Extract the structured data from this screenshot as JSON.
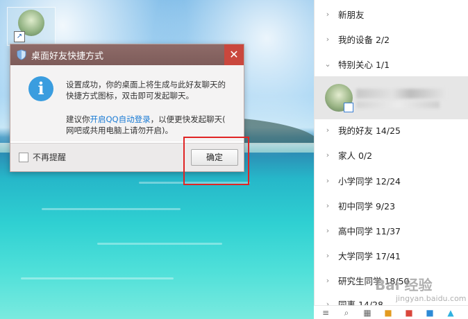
{
  "dialog": {
    "title": "桌面好友快捷方式",
    "close_symbol": "✕",
    "message_line1": "设置成功，你的桌面上将生成与此好友聊天的",
    "message_line2": "快捷方式图标，双击即可发起聊天。",
    "suggest_prefix": "建议你",
    "suggest_link": "开启QQ自动登录",
    "suggest_suffix": "，以便更快发起聊天(",
    "suggest_line2": "网吧或共用电脑上请勿开启)。",
    "info_symbol": "i",
    "dont_remind_label": "不再提醒",
    "confirm_button": "确定"
  },
  "contacts": {
    "groups": [
      {
        "label": "新朋友",
        "chevron": "›",
        "expanded": false
      },
      {
        "label": "我的设备 2/2",
        "chevron": "›",
        "expanded": false
      },
      {
        "label": "特别关心 1/1",
        "chevron": "⌄",
        "expanded": true
      },
      {
        "label": "我的好友 14/25",
        "chevron": "›",
        "expanded": false
      },
      {
        "label": "家人 0/2",
        "chevron": "›",
        "expanded": false
      },
      {
        "label": "小学同学 12/24",
        "chevron": "›",
        "expanded": false
      },
      {
        "label": "初中同学 9/23",
        "chevron": "›",
        "expanded": false
      },
      {
        "label": "高中同学 11/37",
        "chevron": "›",
        "expanded": false
      },
      {
        "label": "大学同学 17/41",
        "chevron": "›",
        "expanded": false
      },
      {
        "label": "研究生同学 18/50",
        "chevron": "›",
        "expanded": false
      },
      {
        "label": "同事 14/28",
        "chevron": "›",
        "expanded": false
      }
    ]
  },
  "watermark": {
    "text": "Bai 经验",
    "sub": "jingyan.baidu.com"
  },
  "colors": {
    "titlebar": "#8e6b68",
    "close_button": "#c9473d",
    "info_icon": "#3a9ddf",
    "link": "#1a7bd4",
    "highlight": "#e02424"
  },
  "icons": {
    "shield": "shield-icon",
    "info": "info-icon",
    "close": "close-icon",
    "shortcut": "shortcut-arrow-icon"
  }
}
